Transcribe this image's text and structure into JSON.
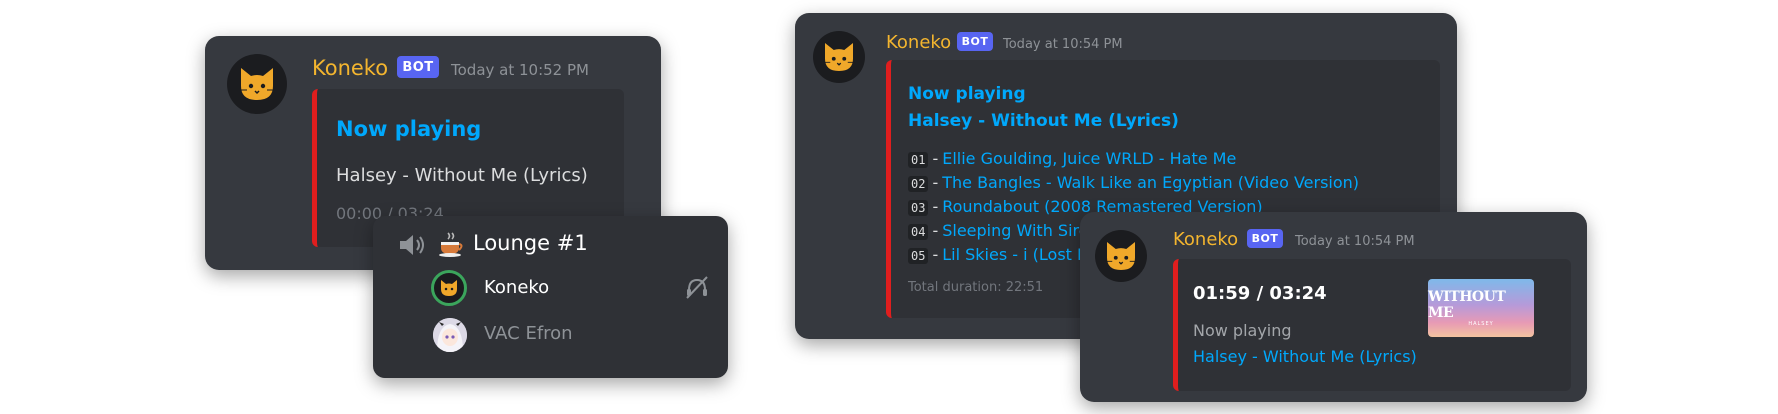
{
  "card1": {
    "username": "Koneko",
    "bot_badge": "BOT",
    "timestamp": "Today at 10:52 PM",
    "embed_title": "Now playing",
    "track": "Halsey - Without Me (Lyrics)",
    "progress": "00:00 / 03:24"
  },
  "voice": {
    "channel_icon": "coffee-cup",
    "channel_name": "Lounge #1",
    "members": [
      {
        "name": "Koneko",
        "avatar": "cat-avatar"
      },
      {
        "name": "VAC Efron",
        "avatar": "anime-girl-avatar"
      }
    ]
  },
  "card2": {
    "username": "Koneko",
    "bot_badge": "BOT",
    "timestamp": "Today at 10:54 PM",
    "embed_title": "Now playing",
    "current_track": "Halsey - Without Me (Lyrics)",
    "queue": [
      {
        "num": "01",
        "title": "Ellie Goulding, Juice WRLD - Hate Me"
      },
      {
        "num": "02",
        "title": "The Bangles - Walk Like an Egyptian (Video Version)"
      },
      {
        "num": "03",
        "title": "Roundabout (2008 Remastered Version)"
      },
      {
        "num": "04",
        "title": "Sleeping With Sire"
      },
      {
        "num": "05",
        "title": "Lil Skies - i (Lost K"
      }
    ],
    "total": "Total duration: 22:51"
  },
  "card3": {
    "username": "Koneko",
    "bot_badge": "BOT",
    "timestamp": "Today at 10:54 PM",
    "progress": "01:59 / 03:24",
    "label": "Now playing",
    "track": "Halsey - Without Me (Lyrics)",
    "thumb_title": "WITHOUT ME",
    "thumb_sub": "HALSEY"
  },
  "colors": {
    "background": "#36393f",
    "embed": "#2f3136",
    "accent_bar": "#e01e1e",
    "link": "#00a8fc",
    "username": "#f3b52f",
    "bot_badge": "#5865f2"
  }
}
